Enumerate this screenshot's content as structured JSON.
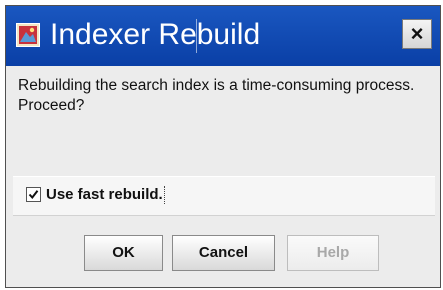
{
  "dialog": {
    "title": "Indexer Rebuild",
    "close_label": "×",
    "message": "Rebuilding the search index is a time-consuming process. Proceed?",
    "checkbox": {
      "label": "Use fast rebuild.",
      "checked": true
    },
    "buttons": {
      "ok": "OK",
      "cancel": "Cancel",
      "help": "Help"
    },
    "help_enabled": false,
    "icons": {
      "title": "app-icon",
      "close": "close-icon",
      "checkbox": "checkmark-icon"
    },
    "colors": {
      "titlebar": "#1a57c0",
      "dialog_background": "#ececec",
      "disabled_text": "#a8a8a8"
    }
  }
}
